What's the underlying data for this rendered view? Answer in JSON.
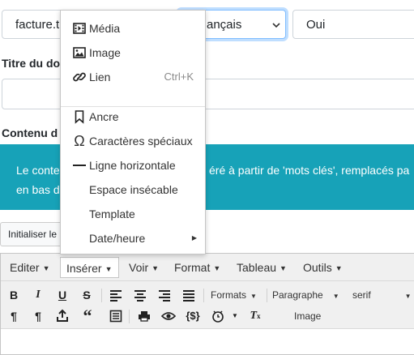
{
  "form": {
    "file_value": "facture.t",
    "language_value": "ançais",
    "oui_value": "Oui",
    "title_label": "Titre du do",
    "content_label": "Contenu d",
    "info_line1_left": "Le conte",
    "info_line1_right": "éré à partir de 'mots clés', remplacés pa",
    "info_line2_left": "en bas d",
    "init_button": "Initialiser le"
  },
  "menubar": {
    "items": [
      "Editer",
      "Insérer",
      "Voir",
      "Format",
      "Tableau",
      "Outils"
    ],
    "active": "Insérer"
  },
  "toolbar": {
    "formats_label": "Formats",
    "paragraph_label": "Paragraphe",
    "font_label": "serif",
    "image_label": "Image"
  },
  "insert_menu": {
    "items": [
      {
        "label": "Média",
        "icon": "media-icon",
        "shortcut": ""
      },
      {
        "label": "Image",
        "icon": "image-icon",
        "shortcut": ""
      },
      {
        "label": "Lien",
        "icon": "link-icon",
        "shortcut": "Ctrl+K"
      },
      {
        "label": "Ancre",
        "icon": "bookmark-icon",
        "shortcut": ""
      },
      {
        "label": "Caractères spéciaux",
        "icon": "omega-icon",
        "shortcut": ""
      },
      {
        "label": "Ligne horizontale",
        "icon": "hr-icon",
        "shortcut": ""
      },
      {
        "label": "Espace insécable",
        "icon": "",
        "shortcut": ""
      },
      {
        "label": "Template",
        "icon": "",
        "shortcut": ""
      },
      {
        "label": "Date/heure",
        "icon": "",
        "shortcut": "",
        "submenu": true
      }
    ]
  },
  "colors": {
    "info_bg": "#17a2b8",
    "focus_border": "#80bdff"
  }
}
